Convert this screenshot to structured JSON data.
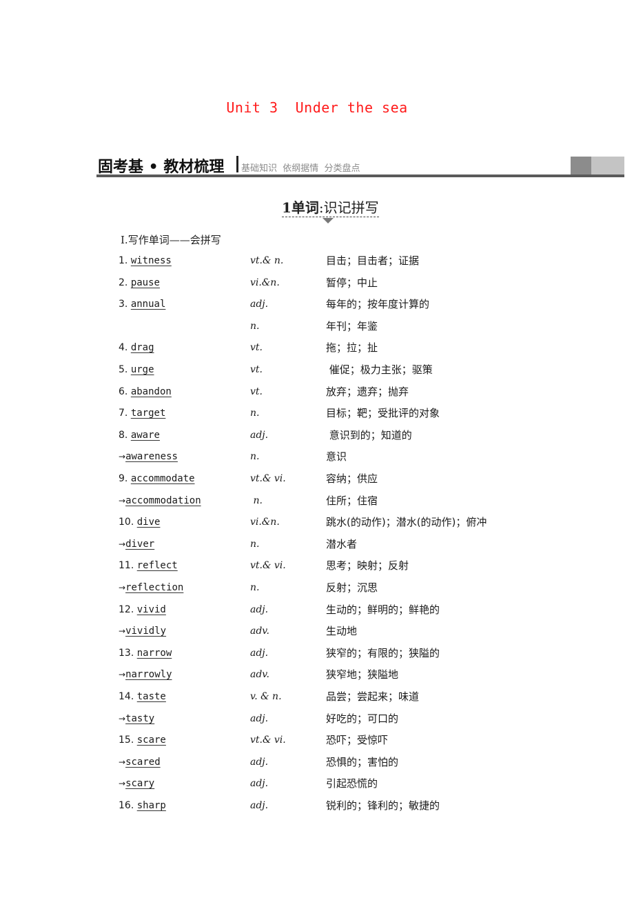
{
  "unit_title": "Unit 3  Under the sea",
  "section_header": {
    "main": "固考基 • 教材梳理",
    "sub": "基础知识  依纲据情  分类盘点"
  },
  "subsection": {
    "number": "1",
    "bold_label": "单词",
    "rest": ":识记拼写"
  },
  "part_heading": "Ⅰ.写作单词——会拼写",
  "colors": {
    "title_red": "#ff1a1a",
    "header_rule": "#5a5a5a",
    "sub_grey": "#8a8a8a"
  },
  "vocab": [
    {
      "prefix": "1. ",
      "word": "witness",
      "pos": "vt.& n.",
      "def": "目击；目击者；证据"
    },
    {
      "prefix": "2. ",
      "word": "pause",
      "pos": "vi.&n.",
      "def": "暂停；中止"
    },
    {
      "prefix": "3. ",
      "word": "annual",
      "pos": "adj.",
      "def": "每年的；按年度计算的"
    },
    {
      "prefix": "",
      "word": "",
      "pos": "n.",
      "def": "年刊；年鉴"
    },
    {
      "prefix": "4. ",
      "word": "drag",
      "pos": "vt.",
      "def": "拖；拉；扯"
    },
    {
      "prefix": "5. ",
      "word": "urge",
      "pos": "vt.",
      "def": " 催促；极力主张；驱策"
    },
    {
      "prefix": "6. ",
      "word": "abandon",
      "pos": "vt.",
      "def": "放弃；遗弃；抛弃"
    },
    {
      "prefix": "7. ",
      "word": "target",
      "pos": "n.",
      "def": "目标；靶；受批评的对象"
    },
    {
      "prefix": "8. ",
      "word": "aware",
      "pos": "adj.",
      "def": " 意识到的；知道的"
    },
    {
      "prefix": "→",
      "word": "awareness",
      "pos": "n.",
      "def": "意识"
    },
    {
      "prefix": "9. ",
      "word": "accommodate",
      "pos": "vt.& vi.",
      "def": "容纳；供应"
    },
    {
      "prefix": "→",
      "word": "accommodation",
      "pos": " n.",
      "def": "住所；住宿"
    },
    {
      "prefix": "10. ",
      "word": "dive",
      "pos": "vi.&n.",
      "def": "跳水(的动作)；潜水(的动作)；俯冲"
    },
    {
      "prefix": "→",
      "word": "diver",
      "pos": "n.",
      "def": "潜水者"
    },
    {
      "prefix": "11. ",
      "word": "reflect",
      "pos": "vt.& vi.",
      "def": "思考；映射；反射"
    },
    {
      "prefix": "→",
      "word": "reflection",
      "pos": "n.",
      "def": "反射；沉思"
    },
    {
      "prefix": "12. ",
      "word": "vivid",
      "pos": "adj.",
      "def": "生动的；鲜明的；鲜艳的"
    },
    {
      "prefix": "→",
      "word": "vividly",
      "pos": "adv.",
      "def": "生动地"
    },
    {
      "prefix": "13. ",
      "word": "narrow",
      "pos": "adj.",
      "def": "狭窄的；有限的；狭隘的"
    },
    {
      "prefix": "→",
      "word": "narrowly",
      "pos": "adv.",
      "def": "狭窄地；狭隘地"
    },
    {
      "prefix": "14. ",
      "word": "taste",
      "pos": "v. & n.",
      "def": "品尝；尝起来；味道"
    },
    {
      "prefix": "→",
      "word": "tasty",
      "pos": "adj.",
      "def": "好吃的；可口的"
    },
    {
      "prefix": "15. ",
      "word": "scare",
      "pos": "vt.& vi.",
      "def": "恐吓；受惊吓"
    },
    {
      "prefix": "→",
      "word": "scared",
      "pos": "adj.",
      "def": "恐惧的；害怕的"
    },
    {
      "prefix": "→",
      "word": "scary",
      "pos": "adj.",
      "def": "引起恐慌的"
    },
    {
      "prefix": "16. ",
      "word": "sharp",
      "pos": "adj.",
      "def": "锐利的；锋利的；敏捷的"
    }
  ]
}
